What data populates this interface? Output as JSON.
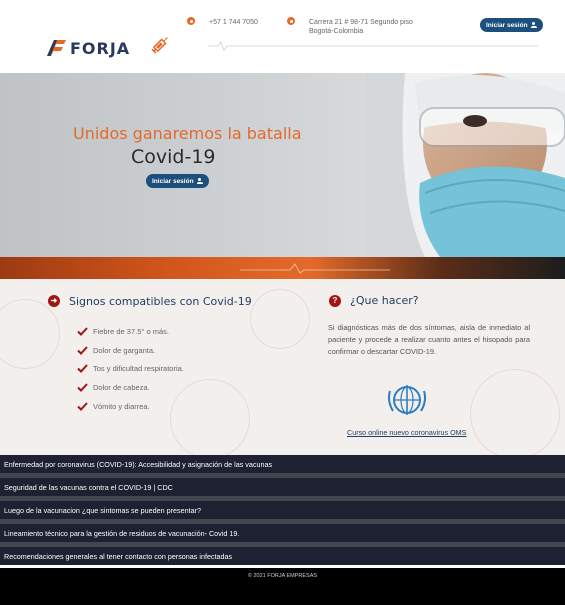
{
  "brand": {
    "name": "FORJA",
    "primary": "#1c4f7c",
    "accent": "#e46a2a",
    "alert": "#a31515"
  },
  "header": {
    "phone": "+57 1 744 7050",
    "address_line1": "Carrera 21 # 98-71 Segundo piso",
    "address_line2": "Bogotá-Colombia",
    "login_label": "Iniciar sesión"
  },
  "hero": {
    "title": "Unidos ganaremos la batalla",
    "subtitle": "Covid-19",
    "login_label": "Iniciar sesión"
  },
  "symptoms": {
    "title": "Signos compatibles con Covid-19",
    "items": [
      "Fiebre de 37.5° o más.",
      "Dolor de garganta.",
      "Tos y dificultad respiratoria.",
      "Dolor de cabeza.",
      "Vómito y diarrea."
    ]
  },
  "what_to_do": {
    "title": "¿Que hacer?",
    "text": "Si diagnósticas más de dos síntomas, aisla de inmediato al paciente y procede a realizar cuanto antes el hisopado para confirmar o descartar COVID-19.",
    "course_link": "Curso online nuevo coronavirus OMS"
  },
  "links": [
    "Enfermedad por coronavirus (COVID-19): Accesibilidad y asignación de las vacunas",
    "Seguridad de las vacunas contra el COVID-19 | CDC",
    "Luego de la vacunacion ¿que sintomas se pueden presentar?",
    "Lineamiento técnico para la gestión de residuos de vacunación- Covid 19.",
    "Recomendaciones generales al tener contacto con personas infectadas"
  ],
  "footer": {
    "copyright": "© 2021 FORJA EMPRESAS"
  }
}
